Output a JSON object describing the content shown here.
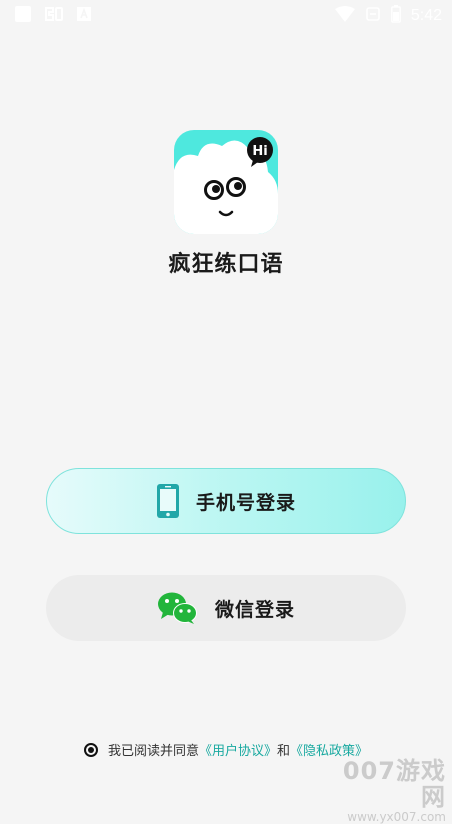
{
  "status_bar": {
    "time": "5:42",
    "icons": [
      "square-notification-icon",
      "app-notification-icon",
      "a-notification-icon",
      "wifi-icon",
      "battery-saver-icon",
      "battery-icon"
    ]
  },
  "app": {
    "name": "疯狂练口语",
    "icon_badge": "Hi",
    "colors": {
      "icon_bg": "#4ee8de",
      "accent": "#19a9a0"
    }
  },
  "login": {
    "phone_label": "手机号登录",
    "wechat_label": "微信登录"
  },
  "agreement": {
    "checked": true,
    "prefix": "我已阅读并同意",
    "user_agreement": "《用户协议》",
    "conjunction": "和",
    "privacy_policy": "《隐私政策》"
  },
  "watermark": {
    "main": "007游戏网",
    "url": "www.yx007.com"
  }
}
